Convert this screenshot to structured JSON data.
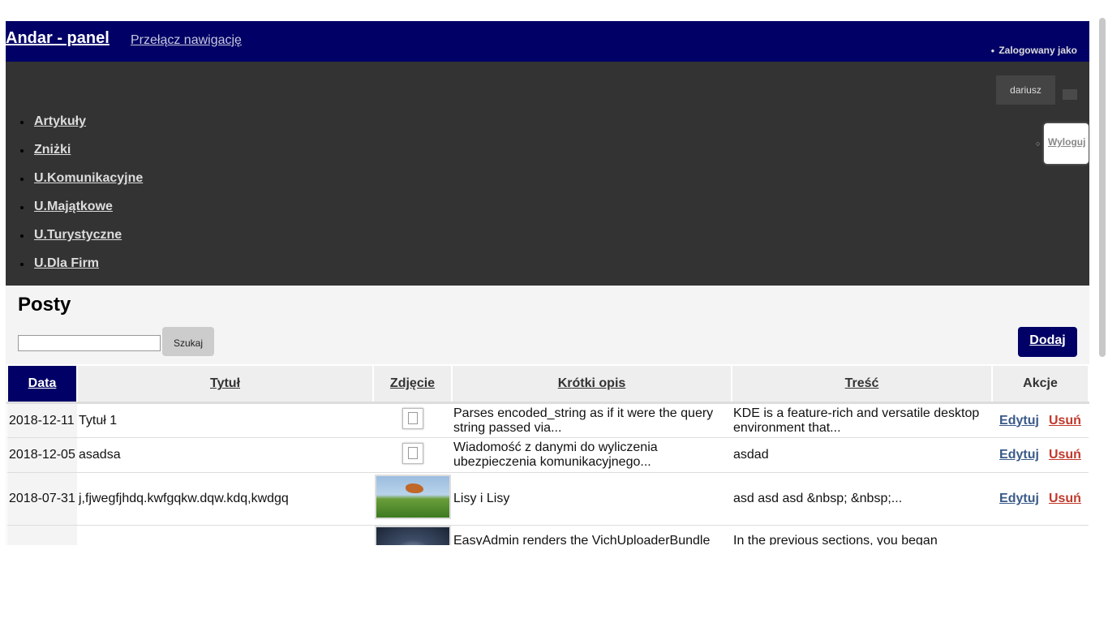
{
  "header": {
    "brand": "Andar - panel",
    "toggle_nav": "Przełącz nawigację",
    "logged_as": "Zalogowany jako",
    "username": "dariusz",
    "logout": "Wyloguj"
  },
  "nav": {
    "items": [
      {
        "label": "Artykuły"
      },
      {
        "label": "Zniżki"
      },
      {
        "label": "U.Komunikacyjne"
      },
      {
        "label": "U.Majątkowe"
      },
      {
        "label": "U.Turystyczne"
      },
      {
        "label": "U.Dla Firm"
      }
    ]
  },
  "main": {
    "title": "Posty",
    "search_value": "",
    "search_button": "Szukaj",
    "add_button": "Dodaj",
    "columns": [
      "Data",
      "Tytuł",
      "Zdjęcie",
      "Krótki opis",
      "Treść",
      "Akcje"
    ],
    "rows": [
      {
        "date": "2018-12-11",
        "title": "Tytuł 1",
        "image": "broken-image-icon",
        "short": "Parses encoded_string as if it were the query string passed via...",
        "content": "KDE is a feature-rich and versatile desktop environment that...",
        "edit": "Edytuj",
        "delete": "Usuń"
      },
      {
        "date": "2018-12-05",
        "title": "asadsa",
        "image": "broken-image-icon",
        "short": "Wiadomość z danymi do wyliczenia ubezpieczenia komunikacyjnego...",
        "content": "asdad",
        "edit": "Edytuj",
        "delete": "Usuń"
      },
      {
        "date": "2018-07-31",
        "title": "j,fjwegfjhdq.kwfgqkw.dqw.kdq,kwdgq",
        "image": "fox-photo",
        "short": "Lisy i Lisy",
        "content": "asd asd asd &nbsp; &nbsp;...",
        "edit": "Edytuj",
        "delete": "Usuń"
      },
      {
        "date": "",
        "title": "",
        "image": "night-photo",
        "short": "EasyAdmin renders the VichUploaderBundle",
        "content": "In the previous sections, you began",
        "edit": "",
        "delete": ""
      }
    ]
  },
  "colors": {
    "navy": "#000066",
    "dark": "#333333",
    "edit": "#3a5a88",
    "delete": "#c0392b"
  }
}
